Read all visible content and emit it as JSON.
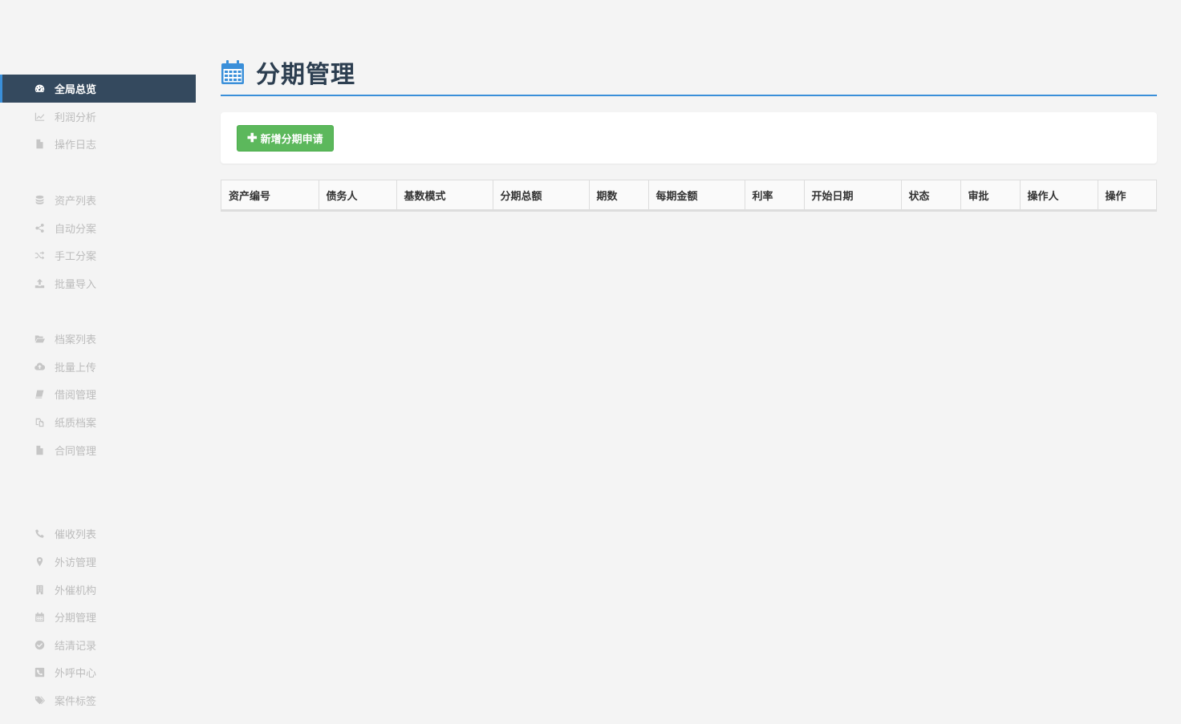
{
  "sidebar": {
    "items": [
      {
        "label": "全局总览",
        "icon": "dashboard-icon",
        "active": true
      },
      {
        "label": "利润分析",
        "icon": "line-chart-icon"
      },
      {
        "label": "操作日志",
        "icon": "file-icon"
      },
      {
        "label": "资产列表",
        "icon": "database-icon"
      },
      {
        "label": "自动分案",
        "icon": "share-icon"
      },
      {
        "label": "手工分案",
        "icon": "shuffle-icon"
      },
      {
        "label": "批量导入",
        "icon": "upload-icon"
      },
      {
        "label": "档案列表",
        "icon": "folder-open-icon"
      },
      {
        "label": "批量上传",
        "icon": "cloud-upload-icon"
      },
      {
        "label": "借阅管理",
        "icon": "book-icon"
      },
      {
        "label": "纸质档案",
        "icon": "copy-icon"
      },
      {
        "label": "合同管理",
        "icon": "file-icon"
      },
      {
        "label": "催收列表",
        "icon": "phone-icon"
      },
      {
        "label": "外访管理",
        "icon": "map-marker-icon"
      },
      {
        "label": "外催机构",
        "icon": "building-icon"
      },
      {
        "label": "分期管理",
        "icon": "calendar-icon"
      },
      {
        "label": "结清记录",
        "icon": "check-circle-icon"
      },
      {
        "label": "外呼中心",
        "icon": "phone-square-icon"
      },
      {
        "label": "案件标签",
        "icon": "tags-icon"
      }
    ]
  },
  "header": {
    "title": "分期管理",
    "icon": "calendar-icon",
    "accent": "#3a8fd9"
  },
  "toolbar": {
    "add_label": "新增分期申请",
    "add_color": "#5cb85c"
  },
  "table": {
    "columns": [
      "资产编号",
      "债务人",
      "基数模式",
      "分期总额",
      "期数",
      "每期金额",
      "利率",
      "开始日期",
      "状态",
      "审批",
      "操作人",
      "操作"
    ]
  }
}
